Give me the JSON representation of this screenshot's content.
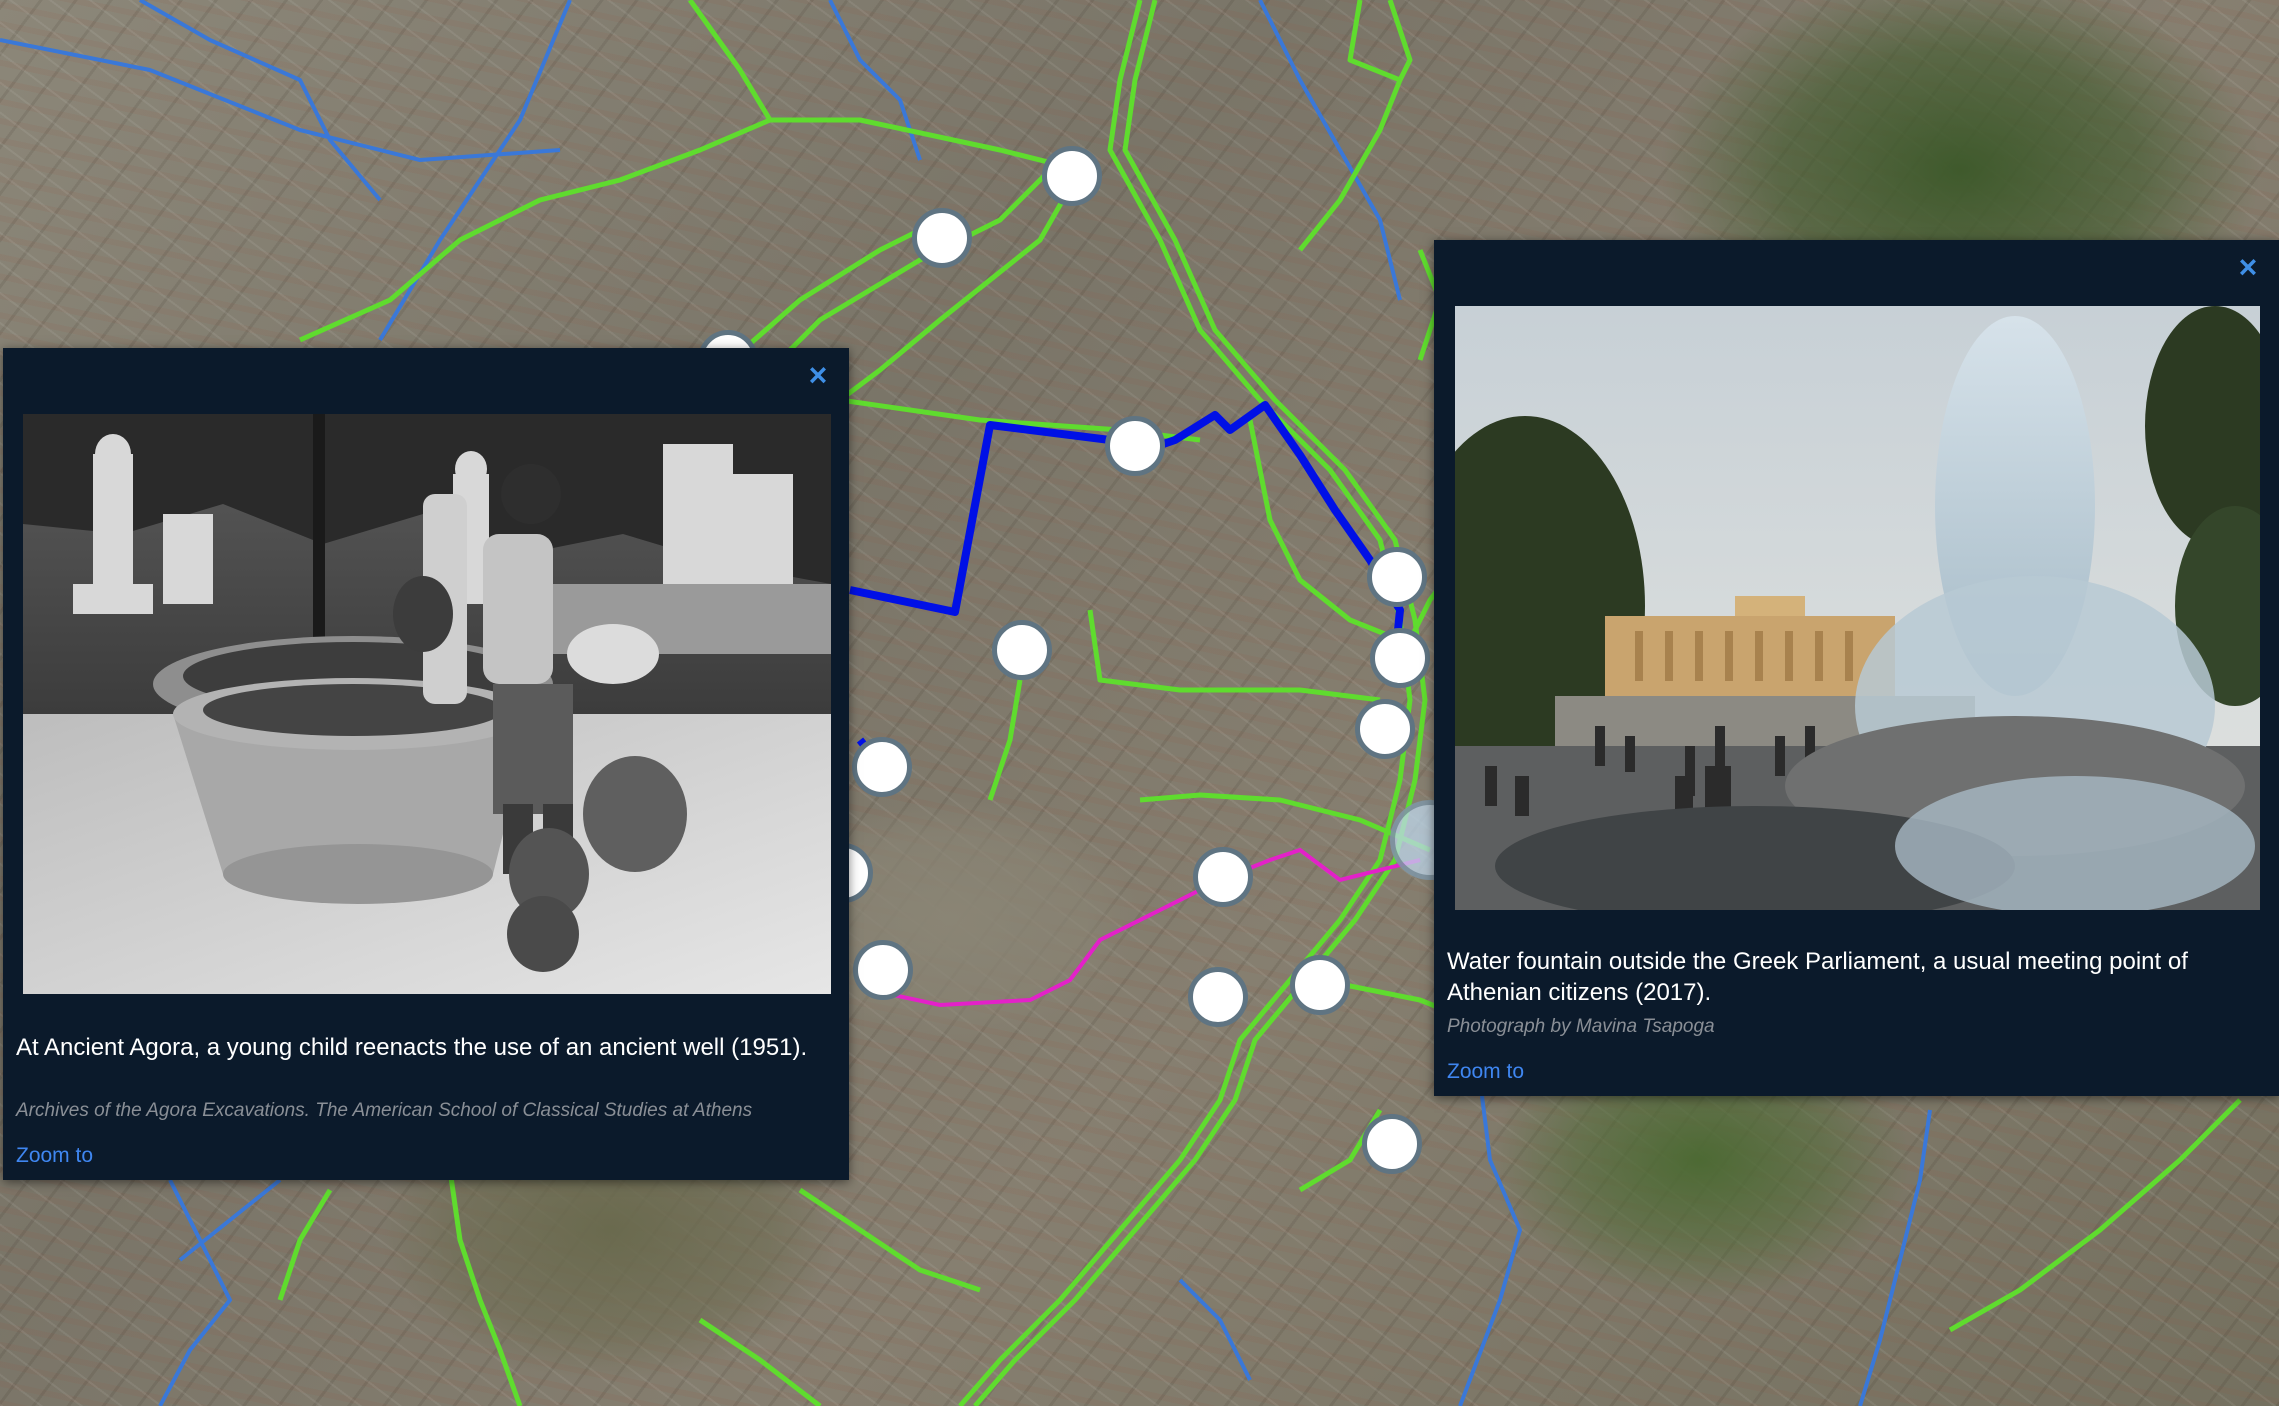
{
  "map": {
    "colors": {
      "route_green": "#5fdc2e",
      "route_blue_light": "#3a78d8",
      "route_blue_bold": "#0010e6",
      "route_magenta": "#e321c9",
      "marker_fill": "#ffffff",
      "marker_border": "#5f7482"
    }
  },
  "popups": [
    {
      "close_icon": "×",
      "photo_subject": "black-and-white photo of a boy pouring water at an ancient well",
      "caption": "At Ancient Agora, a young child reenacts the use of an ancient well (1951).",
      "credit": "Archives of the Agora Excavations. The American School of Classical Studies at Athens",
      "zoom_label": "Zoom to"
    },
    {
      "close_icon": "×",
      "photo_subject": "colour photo of a fountain in front of the Greek Parliament",
      "caption": "Water fountain outside the Greek Parliament, a usual meeting point of Athenian citizens (2017).",
      "credit": "Photograph by Mavina Tsapoga",
      "zoom_label": "Zoom to"
    }
  ]
}
